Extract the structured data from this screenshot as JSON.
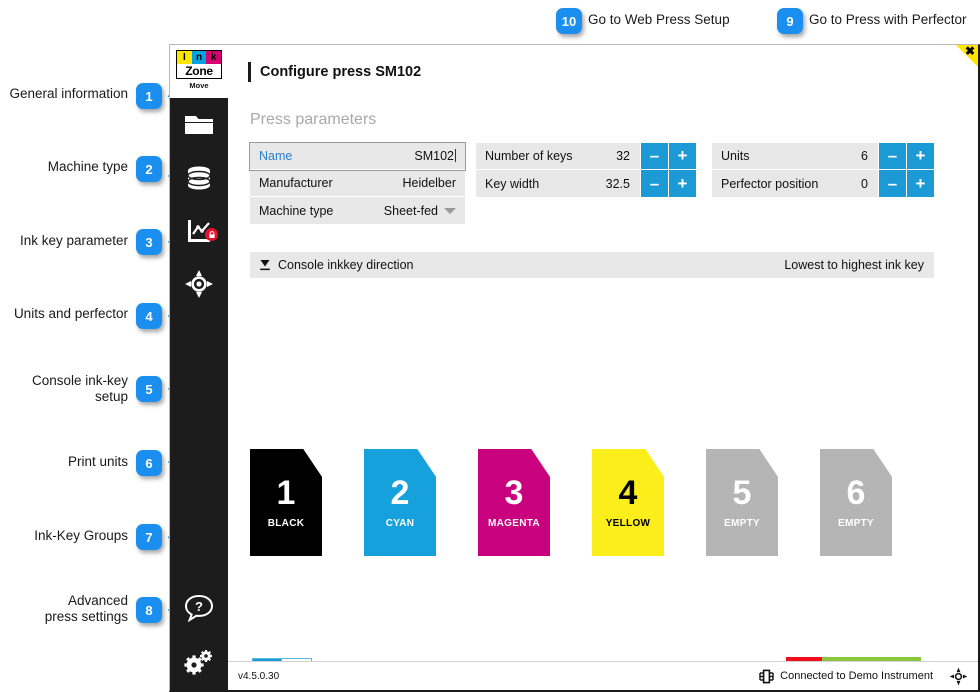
{
  "top_links": [
    {
      "num": "10",
      "label": "Go to Web Press Setup"
    },
    {
      "num": "9",
      "label": "Go to Press with Perfector"
    }
  ],
  "annotations": [
    {
      "num": "1",
      "label": "General information"
    },
    {
      "num": "2",
      "label": "Machine type"
    },
    {
      "num": "3",
      "label": "Ink key parameter"
    },
    {
      "num": "4",
      "label": "Units and perfector"
    },
    {
      "num": "5",
      "label": "Console ink-key\nsetup"
    },
    {
      "num": "6",
      "label": "Print units"
    },
    {
      "num": "7",
      "label": "Ink-Key Groups"
    },
    {
      "num": "8",
      "label": "Advanced\npress settings"
    }
  ],
  "window": {
    "logo": {
      "letters": [
        "I",
        "n",
        "k"
      ],
      "word": "Zone",
      "sub": "Move"
    },
    "title": "Configure press SM102",
    "close_label": "✖"
  },
  "sidebar": {
    "items": [
      {
        "icon": "folder-icon",
        "name": "sidebar-item-jobs"
      },
      {
        "icon": "database-icon",
        "name": "sidebar-item-database"
      },
      {
        "icon": "chart-locked-icon",
        "name": "sidebar-item-curves"
      },
      {
        "icon": "registration-icon",
        "name": "sidebar-item-register"
      }
    ],
    "bottom_items": [
      {
        "icon": "help-icon",
        "name": "sidebar-item-help"
      },
      {
        "icon": "settings-icon",
        "name": "sidebar-item-settings"
      }
    ]
  },
  "main": {
    "heading": "Press parameters",
    "general": {
      "rows": [
        {
          "label": "Name",
          "value": "SM102",
          "type": "text-active"
        },
        {
          "label": "Manufacturer",
          "value": "Heidelber",
          "type": "text"
        },
        {
          "label": "Machine type",
          "value": "Sheet-fed",
          "type": "select"
        }
      ]
    },
    "inkkey": {
      "rows": [
        {
          "label": "Number of keys",
          "value": "32",
          "minus": "–",
          "plus": "+"
        },
        {
          "label": "Key width",
          "value": "32.5",
          "minus": "–",
          "plus": "+"
        }
      ]
    },
    "units": {
      "rows": [
        {
          "label": "Units",
          "value": "6",
          "minus": "–",
          "plus": "+"
        },
        {
          "label": "Perfector position",
          "value": "0",
          "minus": "–",
          "plus": "+"
        }
      ]
    },
    "console": {
      "label": "Console inkkey direction",
      "value": "Lowest to highest ink key",
      "icon": "chevron-down-icon"
    },
    "print_units": [
      {
        "num": "1",
        "name": "BLACK",
        "bg": "#000000",
        "fg": "#ffffff"
      },
      {
        "num": "2",
        "name": "CYAN",
        "bg": "#17a1dc",
        "fg": "#ffffff"
      },
      {
        "num": "3",
        "name": "MAGENTA",
        "bg": "#c9017e",
        "fg": "#ffffff"
      },
      {
        "num": "4",
        "name": "YELLOW",
        "bg": "#fcee1b",
        "fg": "#000000"
      },
      {
        "num": "5",
        "name": "EMPTY",
        "bg": "#b5b5b5",
        "fg": "#ffffff"
      },
      {
        "num": "6",
        "name": "EMPTY",
        "bg": "#b5b5b5",
        "fg": "#ffffff"
      }
    ],
    "tools": [
      {
        "icon": "wrench-icon",
        "name": "ink-key-groups-button"
      },
      {
        "icon": "sliders-icon",
        "name": "advanced-press-settings-button"
      }
    ],
    "actions": {
      "cancel_icon": "undo-icon",
      "confirm_icon": "check-icon"
    }
  },
  "statusbar": {
    "version": "v4.5.0.30",
    "connection": "Connected to Demo Instrument",
    "connection_icon": "chip-icon",
    "right_icon": "registration-icon"
  },
  "colors": {
    "accent": "#1b8ff0",
    "stepper": "#1b9ad6",
    "confirm": "#8cc63f",
    "cancel": "#f20d1b",
    "sidebar": "#1c1c1c",
    "field": "#e8e8e8"
  }
}
